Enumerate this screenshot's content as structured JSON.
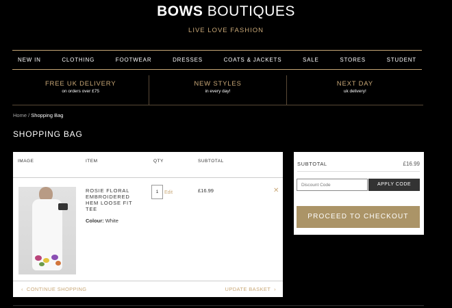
{
  "header": {
    "brand_bold": "BOWS",
    "brand_light": "BOUTIQUES",
    "tagline": "LIVE  LOVE  FASHION"
  },
  "nav": [
    "NEW IN",
    "CLOTHING",
    "FOOTWEAR",
    "DRESSES",
    "COATS & JACKETS",
    "SALE",
    "STORES",
    "STUDENT"
  ],
  "promos": [
    {
      "title": "FREE UK DELIVERY",
      "sub": "on orders over £75"
    },
    {
      "title": "NEW STYLES",
      "sub": "in every day!"
    },
    {
      "title": "NEXT DAY",
      "sub": "uk delivery!"
    }
  ],
  "breadcrumb": {
    "home": "Home",
    "separator": "/",
    "current": "Shopping Bag"
  },
  "page_title": "SHOPPING BAG",
  "bag": {
    "columns": {
      "image": "IMAGE",
      "item": "ITEM",
      "qty": "QTY",
      "subtotal": "SUBTOTAL"
    },
    "item": {
      "name": "ROSIE FLORAL EMBROIDERED HEM LOOSE FIT TEE",
      "colour_label": "Colour:",
      "colour_value": "White",
      "qty": "1",
      "edit_label": "Edit",
      "price": "£16.99",
      "remove_icon": "close-icon"
    },
    "continue_label": "CONTINUE SHOPPING",
    "update_label": "UPDATE BASKET"
  },
  "summary": {
    "subtotal_label": "SUBTOTAL",
    "subtotal_value": "£16.99",
    "discount_placeholder": "Discount Code",
    "apply_label": "APPLY CODE",
    "checkout_label": "PROCEED TO CHECKOUT"
  },
  "colors": {
    "accent": "#c9a877",
    "checkout": "#ab9467",
    "background": "#000000"
  }
}
